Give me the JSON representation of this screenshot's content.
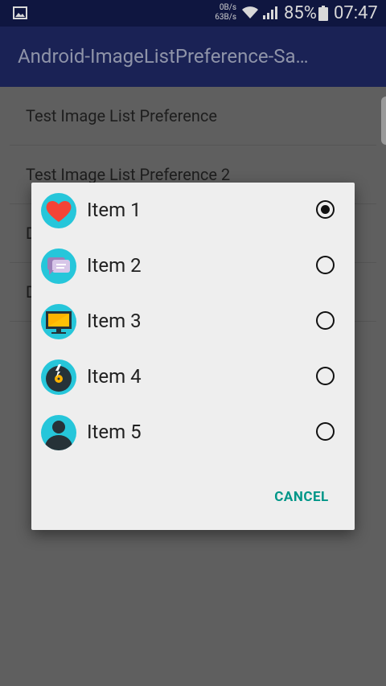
{
  "status_bar": {
    "net_up": "0B/s",
    "net_down": "63B/s",
    "battery": "85%",
    "time": "07:47",
    "icons": [
      "image-icon",
      "wifi-icon",
      "signal-icon",
      "battery-icon"
    ]
  },
  "app_bar": {
    "title": "Android-ImageListPreference-Sa…",
    "background": "#1a2255"
  },
  "preferences": [
    {
      "title": "Test Image List Preference"
    },
    {
      "title": "Test Image List Preference 2"
    },
    {
      "title": "D"
    },
    {
      "title": "D"
    }
  ],
  "dialog": {
    "items": [
      {
        "label": "Item 1",
        "icon": "heart-icon",
        "checked": true
      },
      {
        "label": "Item 2",
        "icon": "chat-bubble-icon",
        "checked": false
      },
      {
        "label": "Item 3",
        "icon": "monitor-icon",
        "checked": false
      },
      {
        "label": "Item 4",
        "icon": "vinyl-record-icon",
        "checked": false
      },
      {
        "label": "Item 5",
        "icon": "person-icon",
        "checked": false
      }
    ],
    "cancel_label": "CANCEL",
    "accent_color": "#009688"
  }
}
